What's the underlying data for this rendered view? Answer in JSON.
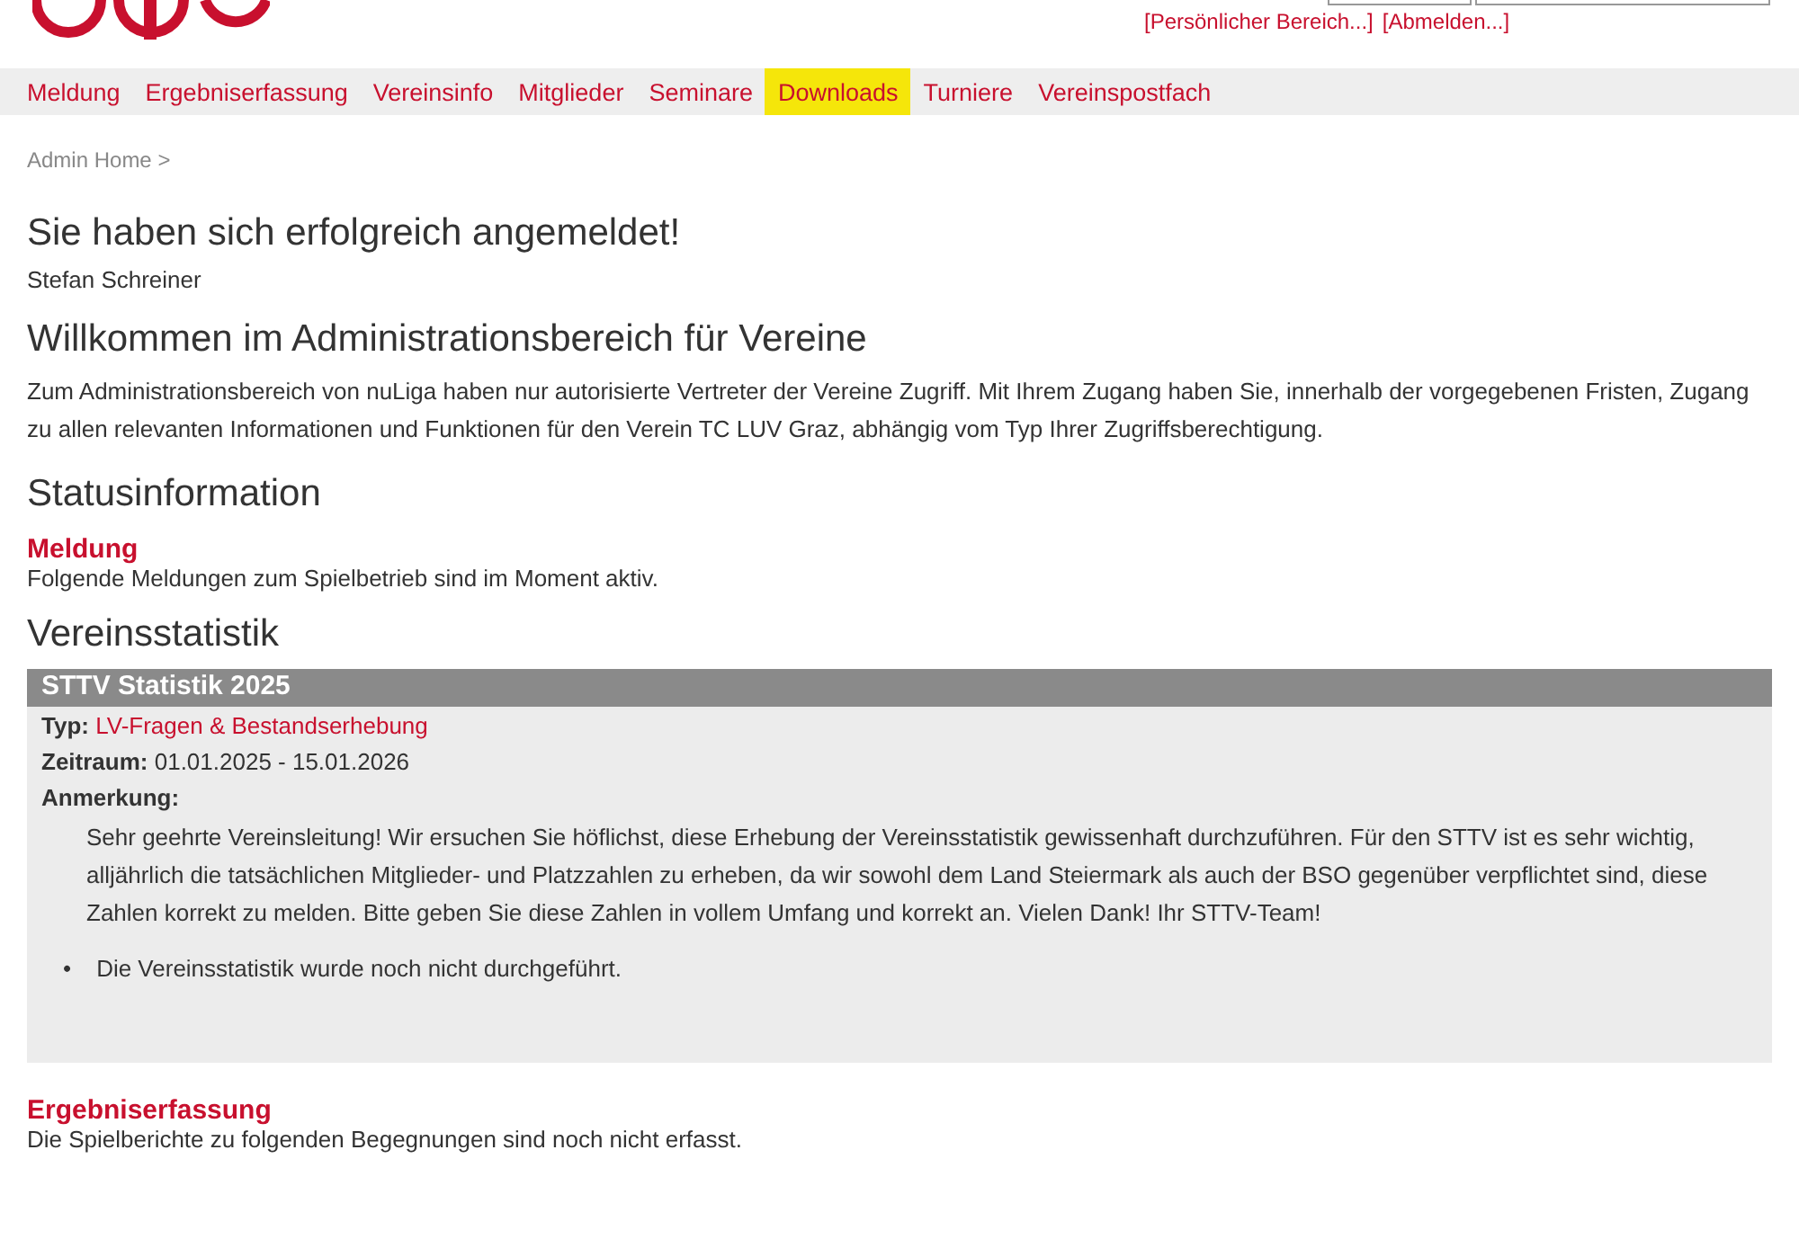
{
  "header": {
    "user_links": [
      "[Persönlicher Bereich...]",
      "[Abmelden...]"
    ]
  },
  "nav": [
    {
      "label": "Meldung",
      "selected": false
    },
    {
      "label": "Ergebniserfassung",
      "selected": false
    },
    {
      "label": "Vereinsinfo",
      "selected": false
    },
    {
      "label": "Mitglieder",
      "selected": false
    },
    {
      "label": "Seminare",
      "selected": false
    },
    {
      "label": "Downloads",
      "selected": true
    },
    {
      "label": "Turniere",
      "selected": false
    },
    {
      "label": "Vereinspostfach",
      "selected": false
    }
  ],
  "breadcrumb": "Admin Home >",
  "login_title": "Sie haben sich erfolgreich angemeldet!",
  "user_name": "Stefan Schreiner",
  "welcome_title": "Willkommen im Administrationsbereich für Vereine",
  "welcome_text": "Zum Administrationsbereich von nuLiga haben nur autorisierte Vertreter der Vereine Zugriff. Mit Ihrem Zugang haben Sie, innerhalb der vorgegebenen Fristen, Zugang zu allen relevanten Informationen und Funktionen für den Verein TC LUV Graz, abhängig vom Typ Ihrer Zugriffsberechtigung.",
  "status_title": "Statusinformation",
  "meldung": {
    "title": "Meldung",
    "text": "Folgende Meldungen zum Spielbetrieb sind im Moment aktiv."
  },
  "stats_title": "Vereinsstatistik",
  "stats_box": {
    "title": "STTV Statistik 2025",
    "type_label": "Typ:",
    "type_value": "LV-Fragen & Bestandserhebung",
    "period_label": "Zeitraum:",
    "period_value": "01.01.2025 - 15.01.2026",
    "note_label": "Anmerkung:",
    "note_text": "Sehr geehrte Vereinsleitung! Wir ersuchen Sie höflichst, diese Erhebung der Vereinsstatistik gewissenhaft durchzuführen. Für den STTV ist es sehr wichtig, alljährlich die tatsächlichen Mitglieder- und Platzzahlen zu erheben, da wir sowohl dem Land Steiermark als auch der BSO gegenüber verpflichtet sind, diese Zahlen korrekt zu melden. Bitte geben Sie diese Zahlen in vollem Umfang und korrekt an. Vielen Dank! Ihr STTV-Team!",
    "bullets": [
      {
        "marker": "•",
        "text": "Die Vereinsstatistik wurde noch nicht durchgeführt."
      }
    ]
  },
  "ergebnis": {
    "title": "Ergebniserfassung",
    "text": "Die Spielberichte zu folgenden Begegnungen sind noch nicht erfasst."
  }
}
